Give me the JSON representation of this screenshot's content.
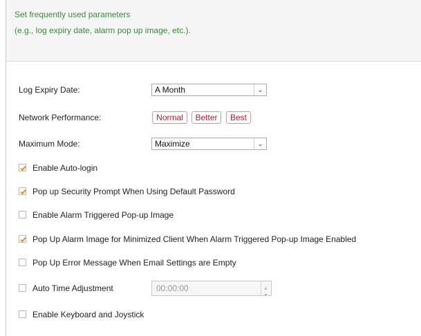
{
  "header": {
    "line1": "Set frequently used parameters",
    "line2": "(e.g., log expiry date, alarm pop up image, etc.)."
  },
  "fields": {
    "log_expiry": {
      "label": "Log Expiry Date:",
      "value": "A Month"
    },
    "network_performance": {
      "label": "Network Performance:",
      "options": [
        "Normal",
        "Better",
        "Best"
      ]
    },
    "maximum_mode": {
      "label": "Maximum Mode:",
      "value": "Maximize"
    }
  },
  "checkboxes": [
    {
      "label": "Enable Auto-login",
      "checked": true
    },
    {
      "label": "Pop up Security Prompt When Using Default Password",
      "checked": true
    },
    {
      "label": "Enable Alarm Triggered Pop-up Image",
      "checked": false
    },
    {
      "label": "Pop Up Alarm Image for Minimized Client When Alarm Triggered Pop-up Image Enabled",
      "checked": true
    },
    {
      "label": "Pop Up Error Message When Email Settings are Empty",
      "checked": false
    },
    {
      "label": "Auto Time Adjustment",
      "checked": false
    },
    {
      "label": "Enable Keyboard and Joystick",
      "checked": false
    }
  ],
  "auto_time": {
    "value": "00:00:00"
  },
  "colors": {
    "accent_check": "#e08a1e",
    "header_text": "#3a8a3a",
    "perf_text": "#b0202a"
  }
}
